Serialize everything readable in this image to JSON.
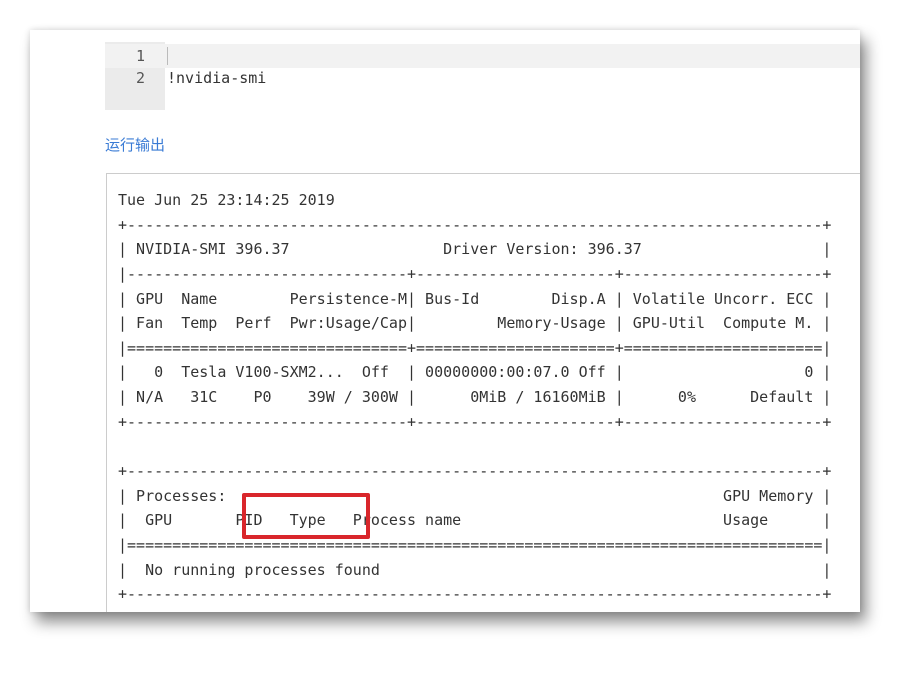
{
  "editor": {
    "lines": [
      {
        "number": "1",
        "text": ""
      },
      {
        "number": "2",
        "text": "!nvidia-smi"
      }
    ]
  },
  "output_label": "运行输出",
  "output_lines": [
    "Tue Jun 25 23:14:25 2019",
    "+-----------------------------------------------------------------------------+",
    "| NVIDIA-SMI 396.37                 Driver Version: 396.37                    |",
    "|-------------------------------+----------------------+----------------------+",
    "| GPU  Name        Persistence-M| Bus-Id        Disp.A | Volatile Uncorr. ECC |",
    "| Fan  Temp  Perf  Pwr:Usage/Cap|         Memory-Usage | GPU-Util  Compute M. |",
    "|===============================+======================+======================|",
    "|   0  Tesla V100-SXM2...  Off  | 00000000:00:07.0 Off |                    0 |",
    "| N/A   31C    P0    39W / 300W |      0MiB / 16160MiB |      0%      Default |",
    "+-------------------------------+----------------------+----------------------+",
    "",
    "+-----------------------------------------------------------------------------+",
    "| Processes:                                                       GPU Memory |",
    "|  GPU       PID   Type   Process name                             Usage      |",
    "|=============================================================================|",
    "|  No running processes found                                                 |",
    "+-----------------------------------------------------------------------------+"
  ],
  "colors": {
    "highlight": "#d9262b",
    "link": "#3a7bd5"
  }
}
